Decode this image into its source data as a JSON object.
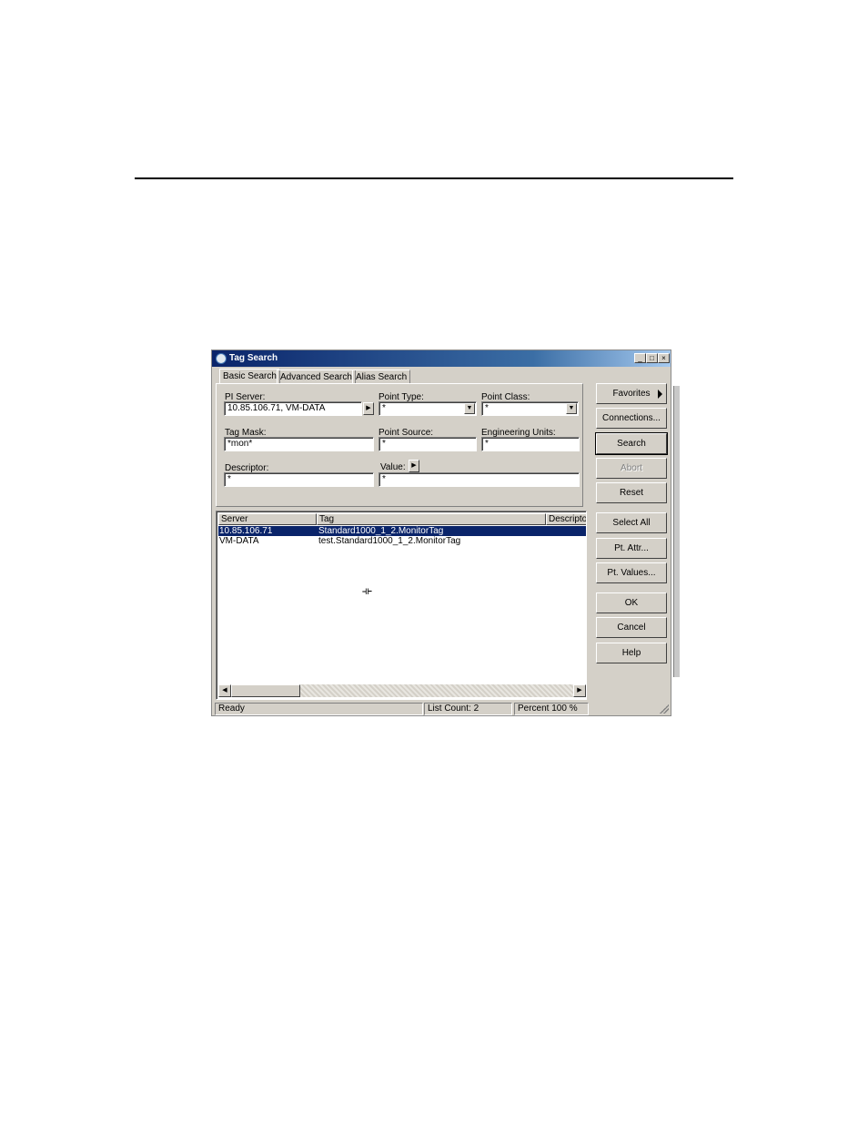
{
  "window": {
    "title": "Tag Search",
    "controls": [
      "_",
      "□",
      "×"
    ]
  },
  "tabs": [
    {
      "label": "Basic Search",
      "active": true
    },
    {
      "label": "Advanced Search",
      "active": false
    },
    {
      "label": "Alias Search",
      "active": false
    }
  ],
  "form": {
    "pi_server_label": "PI Server:",
    "pi_server_value": "10.85.106.71, VM-DATA",
    "point_type_label": "Point Type:",
    "point_type_value": "*",
    "point_class_label": "Point Class:",
    "point_class_value": "*",
    "tag_mask_label": "Tag Mask:",
    "tag_mask_value": "*mon*",
    "point_source_label": "Point Source:",
    "point_source_value": "*",
    "eng_units_label": "Engineering Units:",
    "eng_units_value": "*",
    "descriptor_label": "Descriptor:",
    "descriptor_value": "*",
    "value_label": "Value:",
    "value_value": "*"
  },
  "results": {
    "columns": [
      "Server",
      "Tag",
      "Descriptor"
    ],
    "rows": [
      {
        "server": "10.85.106.71",
        "tag": "Standard1000_1_2.MonitorTag",
        "selected": true
      },
      {
        "server": "VM-DATA",
        "tag": "test.Standard1000_1_2.MonitorTag",
        "selected": false
      }
    ]
  },
  "buttons": {
    "favorites": "Favorites",
    "connections": "Connections...",
    "search": "Search",
    "abort": "Abort",
    "reset": "Reset",
    "select_all": "Select All",
    "pt_attr": "Pt. Attr...",
    "pt_values": "Pt. Values...",
    "ok": "OK",
    "cancel": "Cancel",
    "help": "Help"
  },
  "status": {
    "state": "Ready",
    "list_count": "List Count: 2",
    "percent": "Percent 100 %"
  },
  "colors": {
    "titlebar": "#0a246a",
    "selection": "#0a246a",
    "face": "#d4d0c8"
  }
}
